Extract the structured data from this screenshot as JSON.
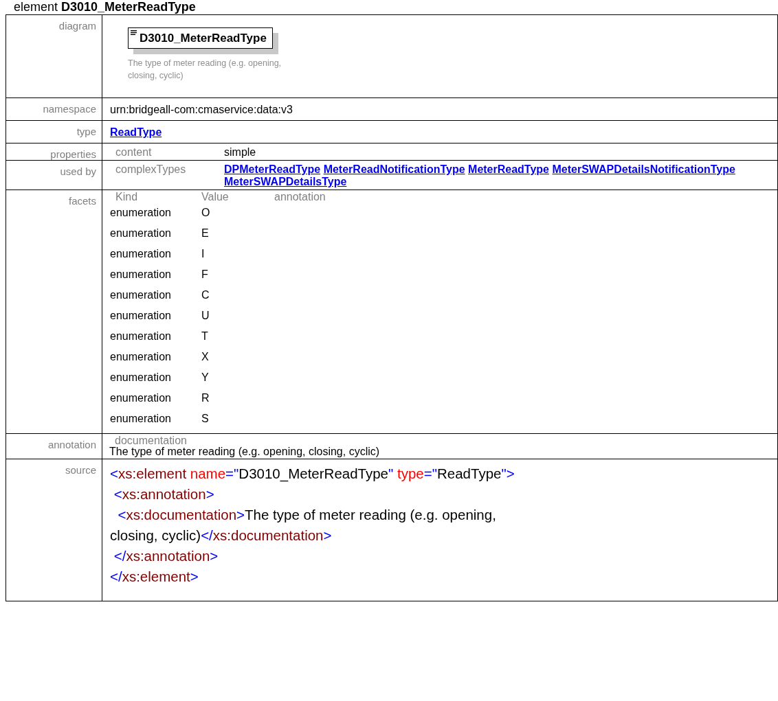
{
  "heading": "element **D3010_MeterReadType**",
  "diagram": {
    "label": "diagram",
    "element_name": "D3010_MeterReadType",
    "annotation": "The type of meter reading (e.g. opening, closing, cyclic)"
  },
  "namespace": {
    "label": "namespace",
    "value": "urn:bridgeall-com:cmaservice:data:v3"
  },
  "type": {
    "label": "type",
    "link": "ReadType"
  },
  "properties": {
    "label": "properties",
    "items": [
      {
        "key": "content",
        "value": "simple"
      }
    ]
  },
  "used_by": {
    "label": "used by",
    "group": "complexTypes",
    "links": [
      "DPMeterReadType",
      "MeterReadNotificationType",
      "MeterReadType",
      "MeterSWAPDetailsNotificationType",
      "MeterSWAPDetailsType"
    ]
  },
  "facets": {
    "label": "facets",
    "columns": [
      "Kind",
      "Value",
      "annotation"
    ],
    "rows": [
      {
        "kind": "enumeration",
        "value": "O"
      },
      {
        "kind": "enumeration",
        "value": "E"
      },
      {
        "kind": "enumeration",
        "value": "I"
      },
      {
        "kind": "enumeration",
        "value": "F"
      },
      {
        "kind": "enumeration",
        "value": "C"
      },
      {
        "kind": "enumeration",
        "value": "U"
      },
      {
        "kind": "enumeration",
        "value": "T"
      },
      {
        "kind": "enumeration",
        "value": "X"
      },
      {
        "kind": "enumeration",
        "value": "Y"
      },
      {
        "kind": "enumeration",
        "value": "R"
      },
      {
        "kind": "enumeration",
        "value": "S"
      }
    ]
  },
  "annotation": {
    "label": "annotation",
    "key": "documentation",
    "text": "The type of meter reading (e.g. opening, closing, cyclic)"
  },
  "source": {
    "label": "source",
    "lines": [
      [
        {
          "kind": "bracket",
          "text": "<"
        },
        {
          "kind": "tag",
          "text": "xs:element"
        },
        {
          "kind": "attr",
          "text": " name"
        },
        {
          "kind": "bracket",
          "text": "=\""
        },
        {
          "kind": "text",
          "text": "D3010_MeterReadType"
        },
        {
          "kind": "bracket",
          "text": "\""
        },
        {
          "kind": "attr",
          "text": " type"
        },
        {
          "kind": "bracket",
          "text": "=\""
        },
        {
          "kind": "text",
          "text": "ReadType"
        },
        {
          "kind": "bracket",
          "text": "\">"
        }
      ],
      [
        {
          "kind": "bracket",
          "text": " <"
        },
        {
          "kind": "tag",
          "text": "xs:annotation"
        },
        {
          "kind": "bracket",
          "text": ">"
        }
      ],
      [
        {
          "kind": "bracket",
          "text": "  <"
        },
        {
          "kind": "tag",
          "text": "xs:documentation"
        },
        {
          "kind": "bracket",
          "text": ">"
        },
        {
          "kind": "text",
          "text": "The type of meter reading (e.g. opening, closing, cyclic)"
        },
        {
          "kind": "bracket",
          "text": "</"
        },
        {
          "kind": "tag",
          "text": "xs:documentation"
        },
        {
          "kind": "bracket",
          "text": ">"
        }
      ],
      [
        {
          "kind": "bracket",
          "text": " </"
        },
        {
          "kind": "tag",
          "text": "xs:annotation"
        },
        {
          "kind": "bracket",
          "text": ">"
        }
      ],
      [
        {
          "kind": "bracket",
          "text": "</"
        },
        {
          "kind": "tag",
          "text": "xs:element"
        },
        {
          "kind": "bracket",
          "text": ">"
        }
      ]
    ]
  }
}
